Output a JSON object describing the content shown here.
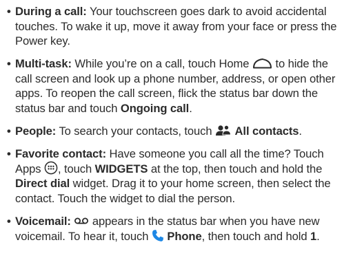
{
  "bullet_glyph": "•",
  "tips": [
    {
      "title": "During a call:",
      "text": "Your touchscreen goes dark to avoid accidental touches. To wake it up, move it away from your face or press the Power key."
    },
    {
      "title": "Multi-task:",
      "text_a": "While you’re on a call, touch Home",
      "text_b": "to hide the call screen and look up a phone number, address, or open other apps. To reopen the call screen, flick the status bar down the status bar and touch",
      "bold_a": "Ongoing call",
      "end": "."
    },
    {
      "title": "People:",
      "text_a": "To search your contacts, touch",
      "bold_a": "All contacts",
      "end": "."
    },
    {
      "title": "Favorite contact:",
      "text_a": "Have someone you call all the time? Touch Apps",
      "text_b": ", touch",
      "bold_a": "WIDGETS",
      "text_c": "at the top, then touch and hold the",
      "bold_b": "Direct dial",
      "text_d": " widget. Drag it to your home screen, then select the contact. Touch the widget to dial the person."
    },
    {
      "title": "Voicemail:",
      "text_a": "appears in the status bar when you have new voicemail. To hear it, touch",
      "bold_a": "Phone",
      "text_b": ", then touch and hold",
      "bold_b": "1",
      "end": "."
    }
  ],
  "icons": {
    "home": "home-icon",
    "people": "people-icon",
    "apps": "apps-icon",
    "voicemail": "voicemail-icon",
    "phone": "phone-icon"
  },
  "colors": {
    "text": "#2b2b2b",
    "phone_icon": "#1e88e5"
  }
}
